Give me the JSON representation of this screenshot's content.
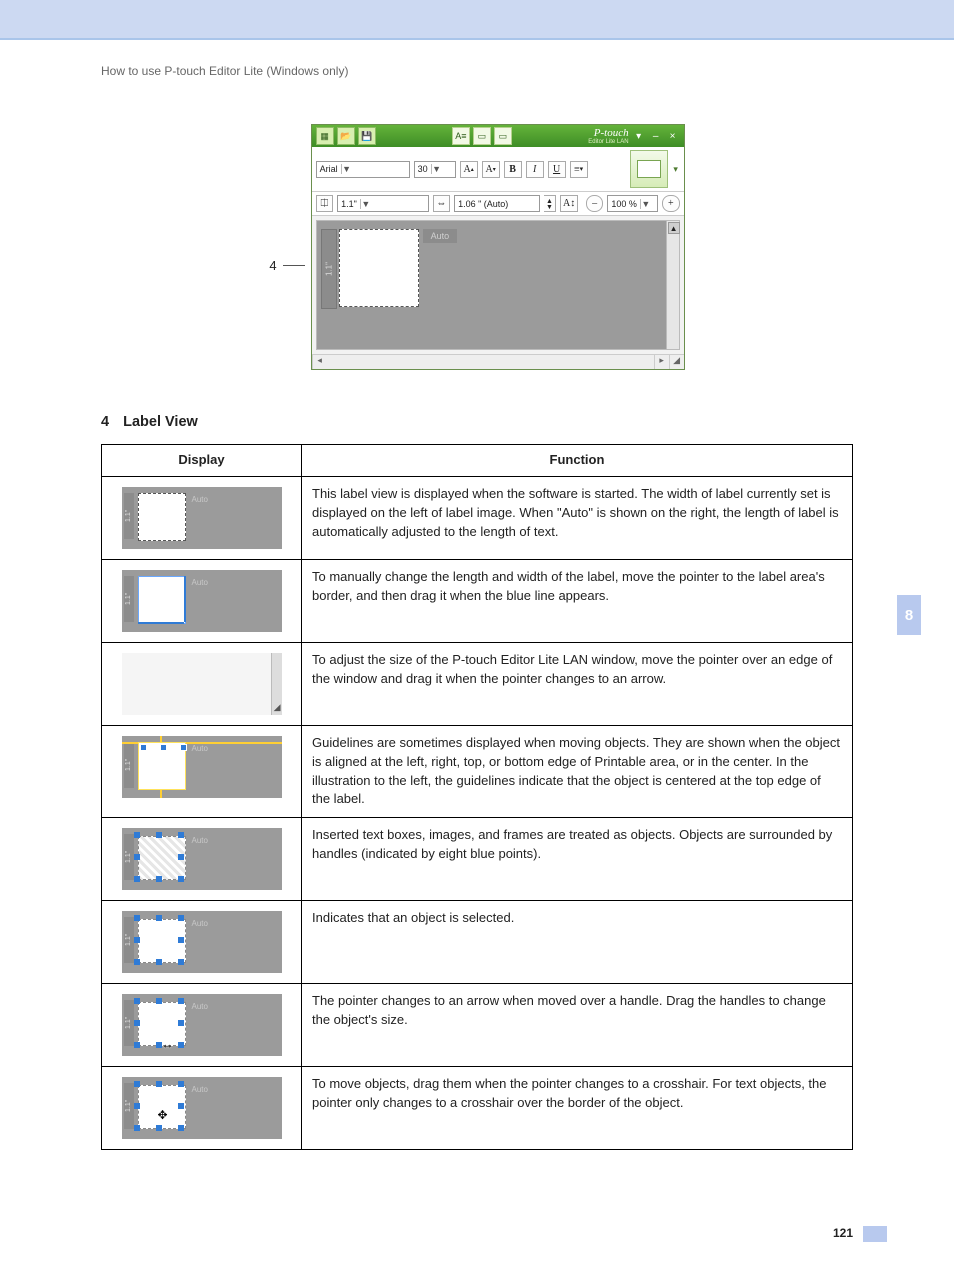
{
  "breadcrumb": "How to use P-touch Editor Lite (Windows only)",
  "side_tab": "8",
  "page_number": "121",
  "callout_label": "4",
  "app": {
    "logo": "P-touch",
    "logo_sub": "Editor Lite LAN",
    "font_name": "Arial",
    "font_size": "30",
    "btn_bigA": "A",
    "btn_smallA": "A",
    "btn_bold": "B",
    "btn_italic": "I",
    "btn_underline": "U",
    "tape_width": "1.1\"",
    "tape_length": "1.06 \" (Auto)",
    "zoom": "100 %",
    "ruler_label": "1.1\"",
    "auto_label": "Auto"
  },
  "section": {
    "num": "4",
    "title": "Label View"
  },
  "table": {
    "head_display": "Display",
    "head_function": "Function",
    "rows": [
      {
        "thumb_auto": "Auto",
        "thumb_ruler": "1.1\"",
        "desc": "This label view is displayed when the software is started. The width of label currently set is displayed on the left of label image. When \"Auto\" is shown on the right, the length of label is automatically adjusted to the length of text."
      },
      {
        "thumb_auto": "Auto",
        "thumb_ruler": "1.1\"",
        "desc": "To manually change the length and width of the label, move the pointer to the label area's border, and then drag it when the blue line appears."
      },
      {
        "thumb_auto": "",
        "thumb_ruler": "",
        "desc": "To adjust the size of the P-touch Editor Lite LAN window, move the pointer over an edge of the window and drag it when the pointer changes to an arrow."
      },
      {
        "thumb_auto": "Auto",
        "thumb_ruler": "1.1\"",
        "desc": "Guidelines are sometimes displayed when moving objects. They are shown when the object is aligned at the left, right, top, or bottom edge of Printable area, or in the center. In the illustration to the left, the guidelines indicate that the object is centered at the top edge of the label."
      },
      {
        "thumb_auto": "Auto",
        "thumb_ruler": "1.1\"",
        "desc": "Inserted text boxes, images, and frames are treated as objects. Objects are surrounded by handles (indicated by eight blue points)."
      },
      {
        "thumb_auto": "Auto",
        "thumb_ruler": "1.1\"",
        "desc": "Indicates that an object is selected."
      },
      {
        "thumb_auto": "Auto",
        "thumb_ruler": "1.1\"",
        "desc": "The pointer changes to an arrow when moved over a handle. Drag the handles to change the object's size."
      },
      {
        "thumb_auto": "Auto",
        "thumb_ruler": "1.1\"",
        "desc": "To move objects, drag them when the pointer changes to a crosshair. For text objects, the pointer only changes to a crosshair over the border of the object."
      }
    ]
  }
}
